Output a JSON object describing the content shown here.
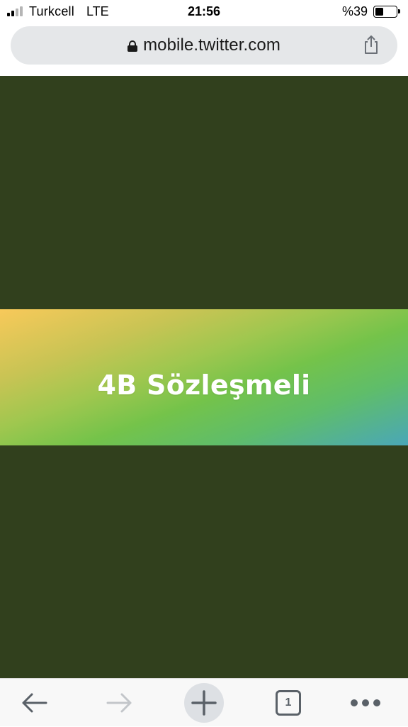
{
  "status_bar": {
    "carrier": "Turkcell",
    "network": "LTE",
    "time": "21:56",
    "battery_percent_label": "%39",
    "battery_level": 0.39,
    "signal_bars_active": 2,
    "signal_bars_total": 4
  },
  "browser": {
    "url": "mobile.twitter.com",
    "secure": true,
    "tab_count": "1",
    "icons": {
      "lock": "lock-icon",
      "share": "share-icon",
      "back": "back-arrow-icon",
      "forward": "forward-arrow-icon",
      "new_tab": "plus-icon",
      "tabs": "tabs-icon",
      "more": "more-icon"
    }
  },
  "page": {
    "background_color": "#31401d",
    "banner_title": "4B Sözleşmeli",
    "banner_gradient": [
      "#f8c95a",
      "#74c34a",
      "#4aa7b8"
    ]
  }
}
